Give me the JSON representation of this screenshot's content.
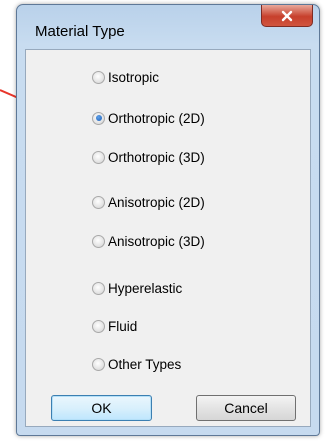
{
  "dialog": {
    "title": "Material Type",
    "close_icon": "close-x-icon",
    "options": [
      {
        "label": "Isotropic",
        "checked": false
      },
      {
        "label": "Orthotropic  (2D)",
        "checked": true
      },
      {
        "label": "Orthotropic  (3D)",
        "checked": false
      },
      {
        "label": "Anisotropic  (2D)",
        "checked": false
      },
      {
        "label": "Anisotropic  (3D)",
        "checked": false
      },
      {
        "label": "Hyperelastic",
        "checked": false
      },
      {
        "label": "Fluid",
        "checked": false
      },
      {
        "label": "Other Types",
        "checked": false
      }
    ],
    "ok_label": "OK",
    "cancel_label": "Cancel"
  },
  "annotation": {
    "arrow_color": "#e8352a"
  },
  "colors": {
    "close_button": "#c7402c",
    "title_bar": "#b9d1ea",
    "radio_selected": "#1c5fb8"
  }
}
